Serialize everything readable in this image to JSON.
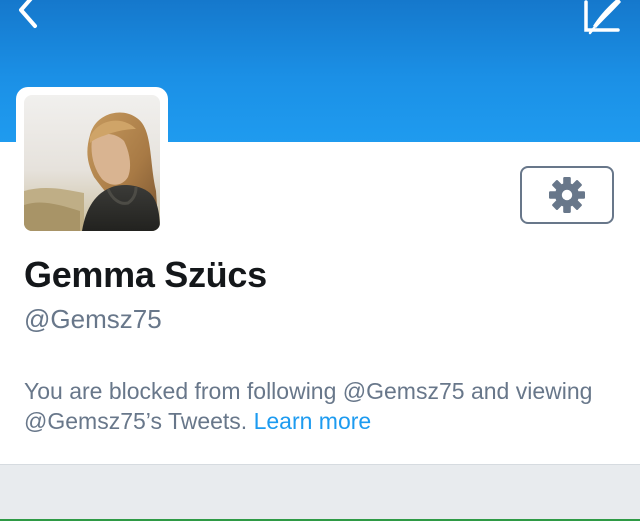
{
  "header": {
    "back_icon": "chevron-left-icon",
    "compose_icon": "compose-tweet-icon",
    "banner_color": "#1b90e6"
  },
  "profile": {
    "avatar_icon": "profile-photo",
    "settings_icon": "gear-icon",
    "name": "Gemma Szücs",
    "handle": "@Gemsz75",
    "blocked_message": "You are blocked from following @Gemsz75 and viewing @Gemsz75’s Tweets.",
    "learn_more_label": "Learn more"
  },
  "colors": {
    "link": "#1d9bf0",
    "muted_text": "#68778a",
    "name_text": "#14171a"
  }
}
